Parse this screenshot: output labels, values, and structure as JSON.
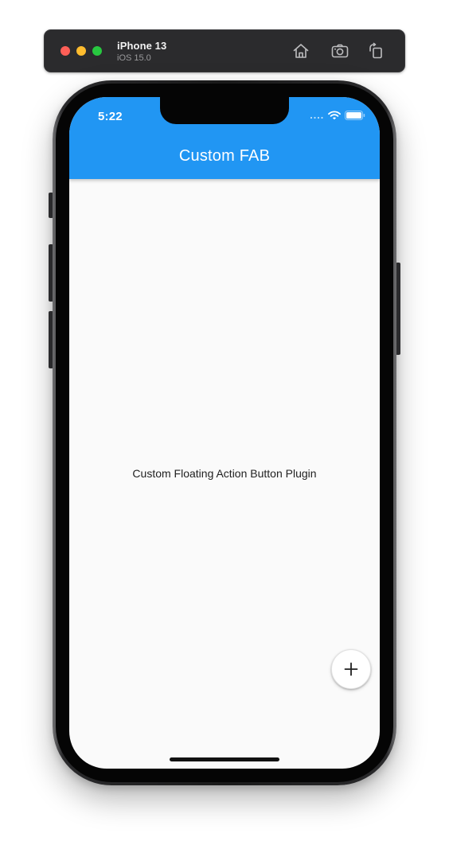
{
  "simulator": {
    "device_name": "iPhone 13",
    "os_version": "iOS 15.0",
    "icons": [
      "home-icon",
      "screenshot-icon",
      "rotate-icon"
    ]
  },
  "status_bar": {
    "time": "5:22",
    "icons": [
      "cellular-dots-icon",
      "wifi-icon",
      "battery-icon"
    ]
  },
  "app": {
    "title": "Custom FAB",
    "body_text": "Custom Floating Action Button Plugin",
    "fab_icon": "plus-icon"
  },
  "colors": {
    "app_bar": "#2196f3",
    "background": "#fafafa",
    "fab_background": "#ffffff",
    "toolbar": "#2b2b2d"
  }
}
